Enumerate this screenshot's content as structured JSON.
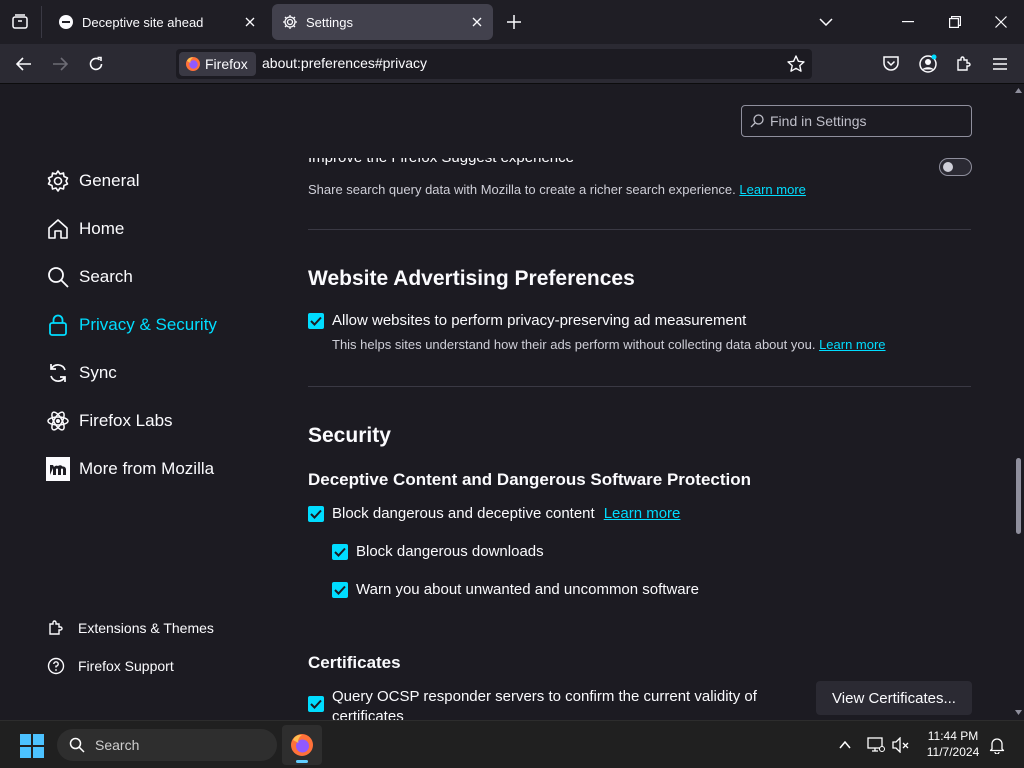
{
  "tabs": [
    {
      "title": "Deceptive site ahead",
      "icon": "blocked-icon",
      "active": false
    },
    {
      "title": "Settings",
      "icon": "gear-icon",
      "active": true
    }
  ],
  "navbar": {
    "identity_label": "Firefox",
    "url": "about:preferences#privacy"
  },
  "find": {
    "placeholder": "Find in Settings"
  },
  "sidebar": {
    "categories": [
      {
        "label": "General",
        "icon": "gear-icon"
      },
      {
        "label": "Home",
        "icon": "home-icon"
      },
      {
        "label": "Search",
        "icon": "search-icon"
      },
      {
        "label": "Privacy & Security",
        "icon": "lock-icon",
        "selected": true
      },
      {
        "label": "Sync",
        "icon": "sync-icon"
      },
      {
        "label": "Firefox Labs",
        "icon": "labs-icon"
      },
      {
        "label": "More from Mozilla",
        "icon": "mozilla-icon"
      }
    ],
    "footer": [
      {
        "label": "Extensions & Themes",
        "icon": "puzzle-icon"
      },
      {
        "label": "Firefox Support",
        "icon": "help-icon"
      }
    ]
  },
  "suggest": {
    "title": "Improve the Firefox Suggest experience",
    "desc": "Share search query data with Mozilla to create a richer search experience.",
    "link": "Learn more",
    "enabled": false
  },
  "ads": {
    "heading": "Website Advertising Preferences",
    "checkbox_label": "Allow websites to perform privacy-preserving ad measurement",
    "desc": "This helps sites understand how their ads perform without collecting data about you.",
    "link": "Learn more"
  },
  "security": {
    "heading": "Security",
    "subheading": "Deceptive Content and Dangerous Software Protection",
    "block_label": "Block dangerous and deceptive content",
    "block_link": "Learn more",
    "downloads_label": "Block dangerous downloads",
    "unwanted_label": "Warn you about unwanted and uncommon software"
  },
  "certificates": {
    "heading": "Certificates",
    "ocsp_line1": "Query OCSP responder servers to confirm the current validity of",
    "ocsp_line2": "certificates",
    "view_button": "View Certificates..."
  },
  "taskbar": {
    "search_placeholder": "Search",
    "time": "11:44 PM",
    "date": "11/7/2024"
  },
  "colors": {
    "accent": "#00ddff",
    "background": "#1c1b22",
    "chrome": "#2b2a33"
  }
}
